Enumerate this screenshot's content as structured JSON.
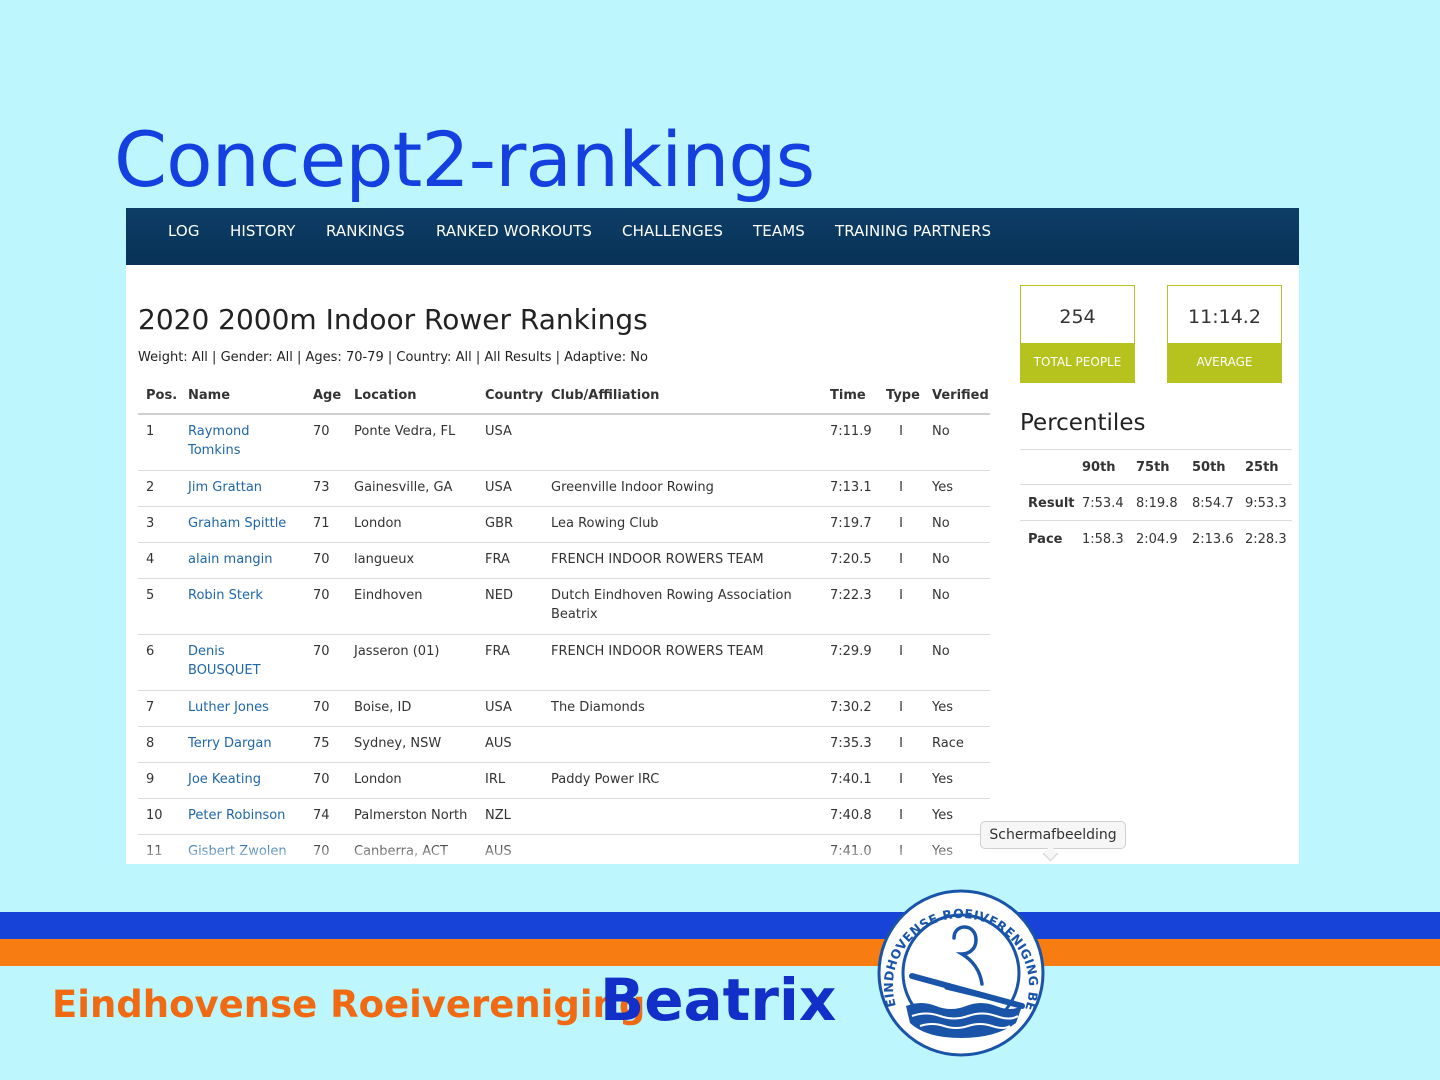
{
  "slide": {
    "title": "Concept2-rankings"
  },
  "nav": {
    "items": [
      "LOG",
      "HISTORY",
      "RANKINGS",
      "RANKED WORKOUTS",
      "CHALLENGES",
      "TEAMS",
      "TRAINING PARTNERS"
    ]
  },
  "rankings": {
    "title": "2020 2000m Indoor Rower Rankings",
    "filters": "Weight: All | Gender: All | Ages: 70-79 | Country: All | All Results | Adaptive: No",
    "columns": [
      "Pos.",
      "Name",
      "Age",
      "Location",
      "Country",
      "Club/Affiliation",
      "Time",
      "Type",
      "Verified"
    ],
    "rows": [
      {
        "pos": "1",
        "name": "Raymond Tomkins",
        "age": "70",
        "location": "Ponte Vedra, FL",
        "country": "USA",
        "club": "",
        "time": "7:11.9",
        "type": "I",
        "verified": "No"
      },
      {
        "pos": "2",
        "name": "Jim Grattan",
        "age": "73",
        "location": "Gainesville, GA",
        "country": "USA",
        "club": "Greenville Indoor Rowing",
        "time": "7:13.1",
        "type": "I",
        "verified": "Yes"
      },
      {
        "pos": "3",
        "name": "Graham Spittle",
        "age": "71",
        "location": "London",
        "country": "GBR",
        "club": "Lea Rowing Club",
        "time": "7:19.7",
        "type": "I",
        "verified": "No"
      },
      {
        "pos": "4",
        "name": "alain mangin",
        "age": "70",
        "location": "langueux",
        "country": "FRA",
        "club": "FRENCH INDOOR ROWERS TEAM",
        "time": "7:20.5",
        "type": "I",
        "verified": "No"
      },
      {
        "pos": "5",
        "name": "Robin Sterk",
        "age": "70",
        "location": "Eindhoven",
        "country": "NED",
        "club": "Dutch Eindhoven Rowing Association Beatrix",
        "time": "7:22.3",
        "type": "I",
        "verified": "No"
      },
      {
        "pos": "6",
        "name": "Denis BOUSQUET",
        "age": "70",
        "location": "Jasseron (01)",
        "country": "FRA",
        "club": "FRENCH INDOOR ROWERS TEAM",
        "time": "7:29.9",
        "type": "I",
        "verified": "No"
      },
      {
        "pos": "7",
        "name": "Luther Jones",
        "age": "70",
        "location": "Boise, ID",
        "country": "USA",
        "club": "The Diamonds",
        "time": "7:30.2",
        "type": "I",
        "verified": "Yes"
      },
      {
        "pos": "8",
        "name": "Terry Dargan",
        "age": "75",
        "location": "Sydney, NSW",
        "country": "AUS",
        "club": "",
        "time": "7:35.3",
        "type": "I",
        "verified": "Race"
      },
      {
        "pos": "9",
        "name": "Joe Keating",
        "age": "70",
        "location": "London",
        "country": "IRL",
        "club": "Paddy Power IRC",
        "time": "7:40.1",
        "type": "I",
        "verified": "Yes"
      },
      {
        "pos": "10",
        "name": "Peter Robinson",
        "age": "74",
        "location": "Palmerston North",
        "country": "NZL",
        "club": "",
        "time": "7:40.8",
        "type": "I",
        "verified": "Yes"
      },
      {
        "pos": "11",
        "name": "Gisbert Zwolen",
        "age": "70",
        "location": "Canberra, ACT",
        "country": "AUS",
        "club": "",
        "time": "7:41.0",
        "type": "I",
        "verified": "Yes"
      }
    ]
  },
  "stats": {
    "total_people": {
      "value": "254",
      "label": "TOTAL PEOPLE"
    },
    "average": {
      "value": "11:14.2",
      "label": "AVERAGE"
    },
    "accent": "#b6c31e"
  },
  "percentiles": {
    "title": "Percentiles",
    "headers": [
      "90th",
      "75th",
      "50th",
      "25th"
    ],
    "rows": [
      {
        "label": "Result",
        "values": [
          "7:53.4",
          "8:19.8",
          "8:54.7",
          "9:53.3"
        ]
      },
      {
        "label": "Pace",
        "values": [
          "1:58.3",
          "2:04.9",
          "2:13.6",
          "2:28.3"
        ]
      }
    ]
  },
  "tooltip": {
    "text": "Schermafbeelding"
  },
  "footer": {
    "club_name": "Eindhovense Roeivereniging",
    "club_highlight": "Beatrix",
    "logo_text": "EINDHOVENSE ROEIVERENIGING BEATRIX",
    "colors": {
      "blue": "#1843d8",
      "orange": "#f77d12"
    }
  }
}
